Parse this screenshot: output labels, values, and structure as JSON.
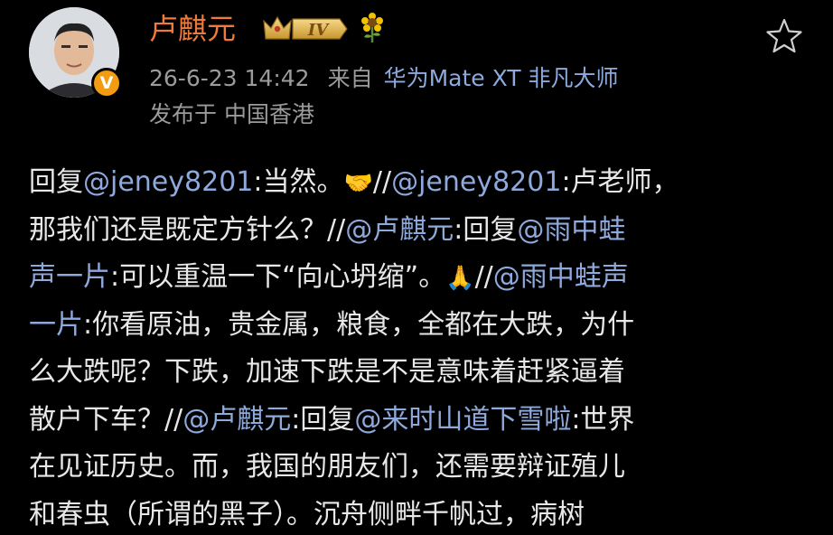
{
  "header": {
    "author_name": "卢麒元",
    "level_badge": "IV",
    "flower_icon": "sunflower-icon",
    "favorite_icon": "star-outline-icon",
    "verified_icon": "verified-v-icon",
    "verified_letter": "V",
    "timestamp": "26-6-23 14:42",
    "source_label": "来自",
    "device": "华为Mate XT 非凡大师",
    "location": "发布于 中国香港"
  },
  "colors": {
    "name": "#f07a39",
    "mention": "#8ea9dc",
    "meta": "#9b9b9b",
    "text": "#e8e8e8",
    "background": "#000000"
  },
  "post": {
    "lines": [
      [
        {
          "t": "回复",
          "k": "text"
        },
        {
          "t": "@jeney8201",
          "k": "mention"
        },
        {
          "t": ":当然。",
          "k": "text"
        },
        {
          "t": "🤝",
          "k": "emoji"
        },
        {
          "t": "//",
          "k": "text"
        },
        {
          "t": "@jeney8201",
          "k": "mention"
        },
        {
          "t": ":卢老师，",
          "k": "text"
        }
      ],
      [
        {
          "t": "那我们还是既定方针么？//",
          "k": "text"
        },
        {
          "t": "@卢麒元",
          "k": "mention"
        },
        {
          "t": ":回复",
          "k": "text"
        },
        {
          "t": "@雨中蛙",
          "k": "mention"
        }
      ],
      [
        {
          "t": "声一片",
          "k": "mention"
        },
        {
          "t": ":可以重温一下“向心坍缩”。",
          "k": "text"
        },
        {
          "t": "🙏",
          "k": "emoji"
        },
        {
          "t": "//",
          "k": "text"
        },
        {
          "t": "@雨中蛙声",
          "k": "mention"
        }
      ],
      [
        {
          "t": "一片",
          "k": "mention"
        },
        {
          "t": ":你看原油，贵金属，粮食，全都在大跌，为什",
          "k": "text"
        }
      ],
      [
        {
          "t": "么大跌呢？下跌，加速下跌是不是意味着赶紧逼着",
          "k": "text"
        }
      ],
      [
        {
          "t": "散户下车？//",
          "k": "text"
        },
        {
          "t": "@卢麒元",
          "k": "mention"
        },
        {
          "t": ":回复",
          "k": "text"
        },
        {
          "t": "@来时山道下雪啦",
          "k": "mention"
        },
        {
          "t": ":世界",
          "k": "text"
        }
      ],
      [
        {
          "t": "在见证历史。而，我国的朋友们，还需要辩证殖儿",
          "k": "text"
        }
      ],
      [
        {
          "t": "和春虫（所谓的黑子）。沉舟侧畔千帆过，病树",
          "k": "text"
        }
      ]
    ]
  }
}
